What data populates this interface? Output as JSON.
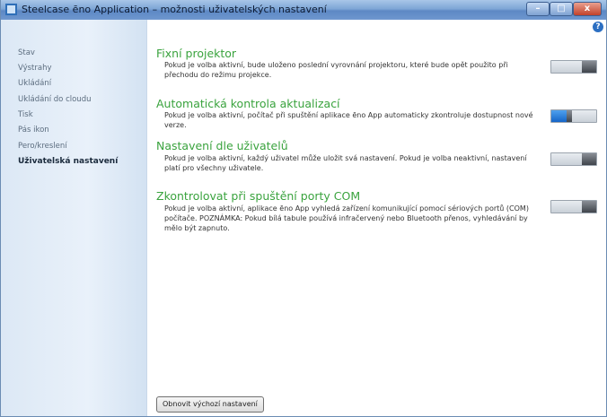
{
  "window": {
    "title": "Steelcase ēno Application – možnosti uživatelských nastavení",
    "icon": "app-icon",
    "controls": {
      "minimize": "–",
      "maximize": "□",
      "close": "x"
    }
  },
  "help_label": "?",
  "sidebar": {
    "items": [
      {
        "label": "Stav",
        "active": false
      },
      {
        "label": "Výstrahy",
        "active": false
      },
      {
        "label": "Ukládání",
        "active": false
      },
      {
        "label": "Ukládání do cloudu",
        "active": false
      },
      {
        "label": "Tisk",
        "active": false
      },
      {
        "label": "Pás ikon",
        "active": false
      },
      {
        "label": "Pero/kreslení",
        "active": false
      },
      {
        "label": "Uživatelská nastavení",
        "active": true
      }
    ]
  },
  "settings": [
    {
      "title": "Fixní projektor",
      "description": "Pokud je volba aktivní, bude uloženo poslední vyrovnání projektoru, které bude opět použito při přechodu do režimu projekce.",
      "enabled": false
    },
    {
      "title": "Automatická kontrola aktualizací",
      "description": "Pokud je volba aktivní, počítač při spuštění aplikace ēno App automaticky zkontroluje dostupnost nové verze.",
      "enabled": true
    },
    {
      "title": "Nastavení dle uživatelů",
      "description": "Pokud je volba aktivní, každý uživatel může uložit svá nastavení. Pokud je volba neaktivní, nastavení platí pro všechny uživatele.",
      "enabled": false
    },
    {
      "title": "Zkontrolovat při spuštění porty COM",
      "description": "Pokud je volba aktivní, aplikace ēno App vyhledá zařízení komunikující pomocí sériových portů (COM) počítače. POZNÁMKA: Pokud bílá tabule používá infračervený nebo Bluetooth přenos, vyhledávání by mělo být zapnuto.",
      "enabled": false
    }
  ],
  "reset_button": "Obnovit výchozí nastavení",
  "colors": {
    "heading": "#3aa33e",
    "toggle_on": "#1565c7",
    "titlebar": "#6e97cf"
  }
}
